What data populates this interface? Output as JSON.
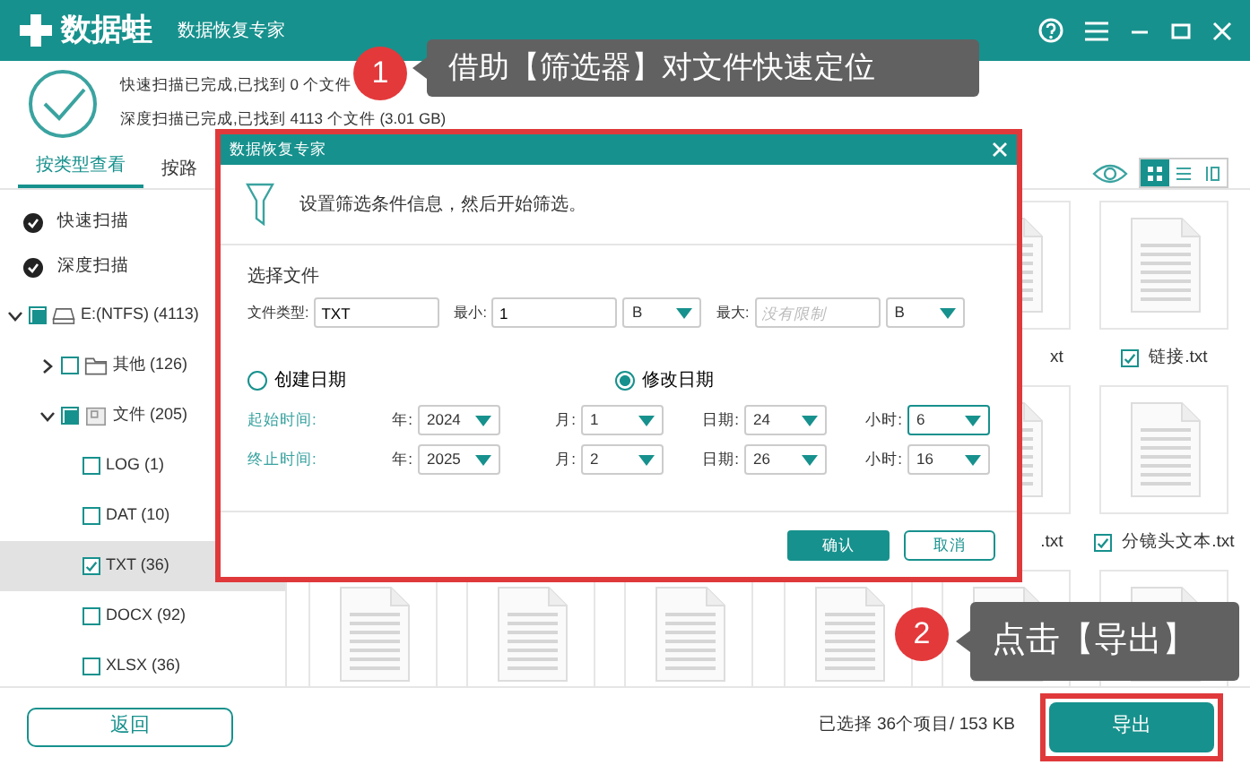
{
  "app": {
    "logo_text": "数据蛙",
    "title": "数据恢复专家"
  },
  "scan_status": [
    "快速扫描已完成,已找到 0 个文件",
    "深度扫描已完成,已找到 4113 个文件 (3.01 GB)"
  ],
  "tabs": [
    {
      "label": "按类型查看",
      "selected": true
    },
    {
      "label": "按路",
      "selected": false
    }
  ],
  "view_modes": [
    {
      "kind": "grid",
      "selected": true
    },
    {
      "kind": "list",
      "selected": false
    },
    {
      "kind": "columns",
      "selected": false
    }
  ],
  "sidebar": {
    "scans": [
      "快速扫描",
      "深度扫描"
    ],
    "tree": [
      {
        "label": "E:(NTFS) (4113)",
        "kind": "drive",
        "checked": false,
        "partial": true,
        "expanded": true,
        "selected": false,
        "children": [
          {
            "label": "其他 (126)",
            "kind": "folder",
            "checked": false,
            "expanded": false,
            "selected": false
          },
          {
            "label": "文件 (205)",
            "kind": "document",
            "checked": false,
            "partial": true,
            "expanded": true,
            "selected": false,
            "children": [
              {
                "label": "LOG (1)",
                "kind": "type",
                "checked": false,
                "selected": false
              },
              {
                "label": "DAT (10)",
                "kind": "type",
                "checked": false,
                "selected": false
              },
              {
                "label": "TXT (36)",
                "kind": "type",
                "checked": true,
                "selected": true
              },
              {
                "label": "DOCX (92)",
                "kind": "type",
                "checked": false,
                "selected": false
              },
              {
                "label": "XLSX (36)",
                "kind": "type",
                "checked": false,
                "selected": false
              }
            ]
          }
        ]
      }
    ]
  },
  "file_rows": [
    [
      {
        "kind": "covered"
      },
      {
        "kind": "covered"
      },
      {
        "kind": "covered"
      },
      {
        "kind": "covered"
      },
      {
        "kind": "file",
        "label": "xt"
      },
      {
        "kind": "file",
        "label": "链接.txt",
        "checked": true
      }
    ],
    [
      {
        "kind": "covered"
      },
      {
        "kind": "covered"
      },
      {
        "kind": "covered"
      },
      {
        "kind": "covered"
      },
      {
        "kind": "file",
        "label": ".txt"
      },
      {
        "kind": "file",
        "label": "分镜头文本.txt",
        "checked": true
      }
    ],
    [
      {
        "kind": "file"
      },
      {
        "kind": "file"
      },
      {
        "kind": "file"
      },
      {
        "kind": "file"
      },
      {
        "kind": "file"
      },
      {
        "kind": "file"
      }
    ]
  ],
  "selection_summary": "已选择 36个项目/ 153 KB",
  "buttons": {
    "back": "返回",
    "export": "导出"
  },
  "dialog": {
    "title": "数据恢复专家",
    "intro": "设置筛选条件信息，然后开始筛选。",
    "section": "选择文件",
    "fields": [
      {
        "kind": "text",
        "label": "文件类型:",
        "value": "TXT"
      },
      {
        "kind": "text",
        "label": "最小:",
        "value": "1"
      },
      {
        "kind": "select",
        "value": "B"
      },
      {
        "kind": "text",
        "label": "最大:",
        "placeholder": "没有限制"
      },
      {
        "kind": "select",
        "value": "B"
      }
    ],
    "date_modes": [
      {
        "label": "创建日期",
        "selected": false
      },
      {
        "label": "修改日期",
        "selected": true
      }
    ],
    "time_rows": [
      {
        "label": "起始时间:",
        "parts": [
          {
            "label": "年:",
            "value": "2024",
            "focused": false
          },
          {
            "label": "月:",
            "value": "1",
            "focused": false
          },
          {
            "label": "日期:",
            "value": "24",
            "focused": false
          },
          {
            "label": "小时:",
            "value": "6",
            "focused": true
          }
        ]
      },
      {
        "label": "终止时间:",
        "parts": [
          {
            "label": "年:",
            "value": "2025",
            "focused": false
          },
          {
            "label": "月:",
            "value": "2",
            "focused": false
          },
          {
            "label": "日期:",
            "value": "26",
            "focused": false
          },
          {
            "label": "小时:",
            "value": "16",
            "focused": false
          }
        ]
      }
    ],
    "buttons": [
      "确认",
      "取消"
    ]
  },
  "callouts": [
    {
      "number": "1",
      "text": "借助【筛选器】对文件快速定位"
    },
    {
      "number": "2",
      "text": "点击【导出】"
    }
  ]
}
